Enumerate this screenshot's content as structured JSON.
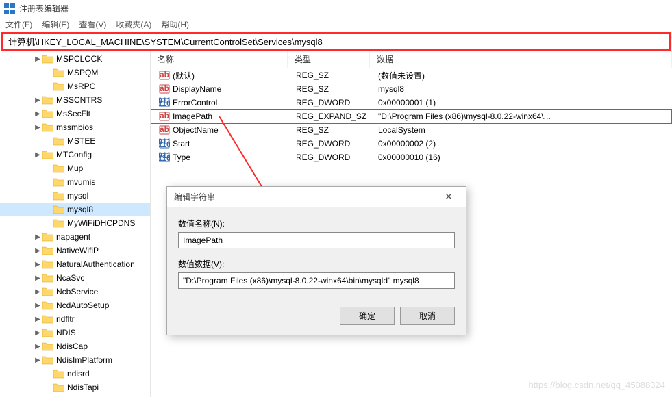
{
  "window": {
    "title": "注册表编辑器"
  },
  "menu": {
    "file": "文件(F)",
    "edit": "编辑(E)",
    "view": "查看(V)",
    "fav": "收藏夹(A)",
    "help": "帮助(H)"
  },
  "address": {
    "value": "计算机\\HKEY_LOCAL_MACHINE\\SYSTEM\\CurrentControlSet\\Services\\mysql8"
  },
  "tree": {
    "items": [
      {
        "label": "MSPCLOCK",
        "exp": ">",
        "indent": 1
      },
      {
        "label": "MSPQM",
        "exp": "none",
        "indent": 2
      },
      {
        "label": "MsRPC",
        "exp": "none",
        "indent": 2
      },
      {
        "label": "MSSCNTRS",
        "exp": ">",
        "indent": 1
      },
      {
        "label": "MsSecFlt",
        "exp": ">",
        "indent": 1
      },
      {
        "label": "mssmbios",
        "exp": ">",
        "indent": 1
      },
      {
        "label": "MSTEE",
        "exp": "none",
        "indent": 2
      },
      {
        "label": "MTConfig",
        "exp": ">",
        "indent": 1
      },
      {
        "label": "Mup",
        "exp": "none",
        "indent": 2
      },
      {
        "label": "mvumis",
        "exp": "none",
        "indent": 2
      },
      {
        "label": "mysql",
        "exp": "none",
        "indent": 2
      },
      {
        "label": "mysql8",
        "exp": "none",
        "indent": 2,
        "selected": true
      },
      {
        "label": "MyWiFiDHCPDNS",
        "exp": "none",
        "indent": 2
      },
      {
        "label": "napagent",
        "exp": ">",
        "indent": 1
      },
      {
        "label": "NativeWifiP",
        "exp": ">",
        "indent": 1
      },
      {
        "label": "NaturalAuthentication",
        "exp": ">",
        "indent": 1
      },
      {
        "label": "NcaSvc",
        "exp": ">",
        "indent": 1
      },
      {
        "label": "NcbService",
        "exp": ">",
        "indent": 1
      },
      {
        "label": "NcdAutoSetup",
        "exp": ">",
        "indent": 1
      },
      {
        "label": "ndfltr",
        "exp": ">",
        "indent": 1
      },
      {
        "label": "NDIS",
        "exp": ">",
        "indent": 1
      },
      {
        "label": "NdisCap",
        "exp": ">",
        "indent": 1
      },
      {
        "label": "NdisImPlatform",
        "exp": ">",
        "indent": 1
      },
      {
        "label": "ndisrd",
        "exp": "none",
        "indent": 2
      },
      {
        "label": "NdisTapi",
        "exp": "none",
        "indent": 2
      }
    ]
  },
  "columns": {
    "name": "名称",
    "type": "类型",
    "data": "数据"
  },
  "values": [
    {
      "icon": "str",
      "name": "(默认)",
      "type": "REG_SZ",
      "data": "(数值未设置)"
    },
    {
      "icon": "str",
      "name": "DisplayName",
      "type": "REG_SZ",
      "data": "mysql8"
    },
    {
      "icon": "bin",
      "name": "ErrorControl",
      "type": "REG_DWORD",
      "data": "0x00000001 (1)"
    },
    {
      "icon": "str",
      "name": "ImagePath",
      "type": "REG_EXPAND_SZ",
      "data": "\"D:\\Program Files (x86)\\mysql-8.0.22-winx64\\...",
      "highlight": true
    },
    {
      "icon": "str",
      "name": "ObjectName",
      "type": "REG_SZ",
      "data": "LocalSystem"
    },
    {
      "icon": "bin",
      "name": "Start",
      "type": "REG_DWORD",
      "data": "0x00000002 (2)"
    },
    {
      "icon": "bin",
      "name": "Type",
      "type": "REG_DWORD",
      "data": "0x00000010 (16)"
    }
  ],
  "dialog": {
    "title": "编辑字符串",
    "label_name": "数值名称(N):",
    "value_name": "ImagePath",
    "label_data": "数值数据(V):",
    "value_data": "\"D:\\Program Files (x86)\\mysql-8.0.22-winx64\\bin\\mysqld\" mysql8",
    "ok": "确定",
    "cancel": "取消"
  },
  "watermark": "https://blog.csdn.net/qq_45088324"
}
